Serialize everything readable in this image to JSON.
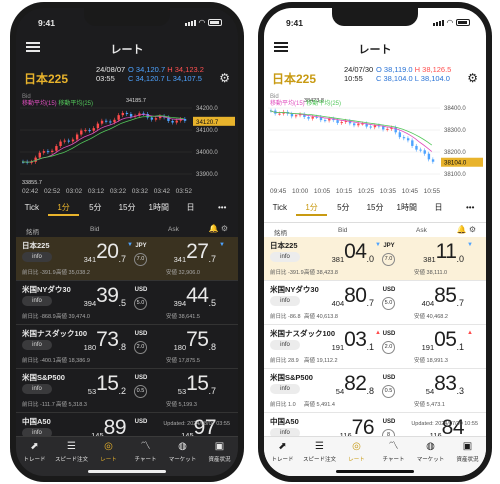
{
  "colors": {
    "accent": "#e8b32c",
    "up": "#ff4b4b",
    "down": "#4ea3ff",
    "ma1": "#e04fbf",
    "ma2": "#52c75a"
  },
  "phones": [
    {
      "theme": "dark",
      "status": {
        "time": "9:41"
      },
      "nav": {
        "title": "レート"
      },
      "quote": {
        "symbol": "日本225",
        "date": "24/08/07",
        "time": "03:55",
        "open": "O 34,120.7",
        "high": "H 34,123.2",
        "close": "C 34,120.7",
        "low": "L 34,107.5"
      },
      "legend": {
        "bid": "Bid",
        "ma1": "移動平均(15)",
        "ma2": "移動平均(25)"
      },
      "chart": {
        "y_ticks": [
          "34200.0",
          "34100.0",
          "34000.0",
          "33900.0"
        ],
        "current": "34120.7",
        "high_label": "34185.7",
        "low_label": "33855.7",
        "x_ticks": [
          "02:42",
          "02:52",
          "03:02",
          "03:12",
          "03:22",
          "03:32",
          "03:42",
          "03:52"
        ]
      },
      "tabs": [
        "Tick",
        "1分",
        "5分",
        "15分",
        "1時間",
        "日",
        "•••"
      ],
      "cols": {
        "name": "銘柄",
        "bid": "Bid",
        "ask": "Ask"
      },
      "rows": [
        {
          "name": "日本225",
          "info": "info",
          "prev": "前日比 -391.9",
          "bid_pre": "341",
          "bid_big": "20",
          "bid_sup": ".7",
          "bid_dir": "dn",
          "ask_pre": "341",
          "ask_big": "27",
          "ask_sup": ".7",
          "ask_dir": "dn",
          "unit": "JPY",
          "spread": "7.0",
          "high": "高値 35,038.2",
          "low": "安値 32,906.0"
        },
        {
          "name": "米国NYダウ30",
          "info": "info",
          "prev": "前日比 -868.9",
          "bid_pre": "394",
          "bid_big": "39",
          "bid_sup": ".5",
          "bid_dir": "",
          "ask_pre": "394",
          "ask_big": "44",
          "ask_sup": ".5",
          "ask_dir": "",
          "unit": "USD",
          "spread": "5.0",
          "high": "高値 39,474.0",
          "low": "安値 38,641.5"
        },
        {
          "name": "米国ナスダック100",
          "info": "info",
          "prev": "前日比 -400.1",
          "bid_pre": "180",
          "bid_big": "73",
          "bid_sup": ".8",
          "bid_dir": "",
          "ask_pre": "180",
          "ask_big": "75",
          "ask_sup": ".8",
          "ask_dir": "",
          "unit": "USD",
          "spread": "2.0",
          "high": "高値 18,386.9",
          "low": "安値 17,875.5"
        },
        {
          "name": "米国S&P500",
          "info": "info",
          "prev": "前日比 -111.7",
          "bid_pre": "53",
          "bid_big": "15",
          "bid_sup": ".2",
          "bid_dir": "",
          "ask_pre": "53",
          "ask_big": "15",
          "ask_sup": ".7",
          "ask_dir": "",
          "unit": "USD",
          "spread": "0.5",
          "high": "高値 5,318.3",
          "low": "安値 5,199.3"
        },
        {
          "name": "中国A50",
          "info": "info",
          "prev": "",
          "bid_pre": "145",
          "bid_big": "89",
          "bid_sup": "",
          "bid_dir": "",
          "ask_pre": "145",
          "ask_big": "97",
          "ask_sup": "",
          "ask_dir": "",
          "unit": "USD",
          "spread": "",
          "high": "",
          "low": ""
        }
      ],
      "updated": "Updated: 2024/08/07 03:55",
      "bottom": [
        {
          "label": "トレード",
          "icon": "⬈"
        },
        {
          "label": "スピード注文",
          "icon": "☰"
        },
        {
          "label": "レート",
          "icon": "◎",
          "active": true
        },
        {
          "label": "チャート",
          "icon": "〽"
        },
        {
          "label": "マーケット",
          "icon": "◍"
        },
        {
          "label": "資産状況",
          "icon": "▣"
        }
      ]
    },
    {
      "theme": "light",
      "status": {
        "time": "9:41"
      },
      "nav": {
        "title": "レート"
      },
      "quote": {
        "symbol": "日本225",
        "date": "24/07/30",
        "time": "10:55",
        "open": "O 38,119.0",
        "high": "H 38,126.5",
        "close": "C 38,104.0",
        "low": "L 38,104.0"
      },
      "legend": {
        "bid": "Bid",
        "ma1": "移動平均(15)",
        "ma2": "移動平均(25)"
      },
      "chart": {
        "y_ticks": [
          "38400.0",
          "38300.0",
          "38200.0",
          "38100.0"
        ],
        "current": "38104.0",
        "high_label": "38423.8",
        "low_label": "",
        "x_ticks": [
          "09:45",
          "10:00",
          "10:05",
          "10:15",
          "10:25",
          "10:35",
          "10:45",
          "10:55"
        ]
      },
      "tabs": [
        "Tick",
        "1分",
        "5分",
        "15分",
        "1時間",
        "日",
        "•••"
      ],
      "cols": {
        "name": "銘柄",
        "bid": "Bid",
        "ask": "Ask"
      },
      "rows": [
        {
          "name": "日本225",
          "info": "info",
          "prev": "前日比 -391.9",
          "bid_pre": "381",
          "bid_big": "04",
          "bid_sup": ".0",
          "bid_dir": "dn",
          "ask_pre": "381",
          "ask_big": "11",
          "ask_sup": ".0",
          "ask_dir": "dn",
          "unit": "JPY",
          "spread": "7.0",
          "high": "高値 38,423.8",
          "low": "安値 38,111.0"
        },
        {
          "name": "米国NYダウ30",
          "info": "info",
          "prev": "前日比 -86.8",
          "bid_pre": "404",
          "bid_big": "80",
          "bid_sup": ".7",
          "bid_dir": "",
          "ask_pre": "404",
          "ask_big": "85",
          "ask_sup": ".7",
          "ask_dir": "",
          "unit": "USD",
          "spread": "5.0",
          "high": "高値 40,613.8",
          "low": "安値 40,468.2"
        },
        {
          "name": "米国ナスダック100",
          "info": "info",
          "prev": "前日比 28.9",
          "bid_pre": "191",
          "bid_big": "03",
          "bid_sup": ".1",
          "bid_dir": "up",
          "ask_pre": "191",
          "ask_big": "05",
          "ask_sup": ".1",
          "ask_dir": "up",
          "unit": "USD",
          "spread": "2.0",
          "high": "高値 19,112.2",
          "low": "安値 18,991.3"
        },
        {
          "name": "米国S&P500",
          "info": "info",
          "prev": "前日比 1.0",
          "bid_pre": "54",
          "bid_big": "82",
          "bid_sup": ".8",
          "bid_dir": "",
          "ask_pre": "54",
          "ask_big": "83",
          "ask_sup": ".3",
          "ask_dir": "",
          "unit": "USD",
          "spread": "0.5",
          "high": "高値 5,491.4",
          "low": "安値 5,473.1"
        },
        {
          "name": "中国A50",
          "info": "info",
          "prev": "前日比 -3,119",
          "bid_pre": "116",
          "bid_big": "76",
          "bid_sup": "",
          "bid_dir": "",
          "ask_pre": "116",
          "ask_big": "84",
          "ask_sup": "",
          "ask_dir": "",
          "unit": "USD",
          "spread": "8",
          "high": "高値 14,749",
          "low": "安値 11,613"
        }
      ],
      "updated": "Updated: 2024/07/30 10:55",
      "bottom": [
        {
          "label": "トレード",
          "icon": "⬈"
        },
        {
          "label": "スピード注文",
          "icon": "☰"
        },
        {
          "label": "レート",
          "icon": "◎",
          "active": true
        },
        {
          "label": "チャート",
          "icon": "〽"
        },
        {
          "label": "マーケット",
          "icon": "◍"
        },
        {
          "label": "資産状況",
          "icon": "▣"
        }
      ]
    }
  ]
}
